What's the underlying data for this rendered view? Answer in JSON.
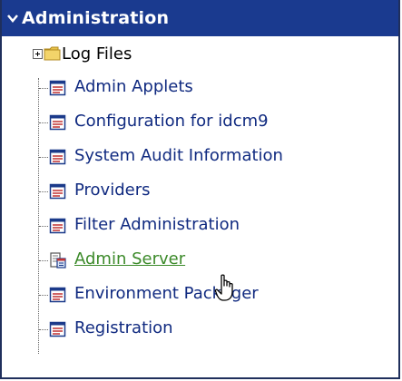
{
  "panel": {
    "title": "Administration"
  },
  "tree": {
    "folder": {
      "label": "Log Files",
      "icon": "folder-icon"
    },
    "items": [
      {
        "label": "Admin Applets",
        "icon": "document-icon",
        "hover": false
      },
      {
        "label": "Configuration for idcm9",
        "icon": "document-icon",
        "hover": false
      },
      {
        "label": "System Audit Information",
        "icon": "document-icon",
        "hover": false
      },
      {
        "label": "Providers",
        "icon": "document-icon",
        "hover": false
      },
      {
        "label": "Filter Administration",
        "icon": "document-icon",
        "hover": false
      },
      {
        "label": "Admin Server",
        "icon": "server-icon",
        "hover": true
      },
      {
        "label": "Environment Packager",
        "icon": "document-icon",
        "hover": false
      },
      {
        "label": "Registration",
        "icon": "document-icon",
        "hover": false
      }
    ]
  },
  "colors": {
    "header_bg": "#1a3a8f",
    "link": "#102a80",
    "link_hover": "#3c8a2a"
  }
}
